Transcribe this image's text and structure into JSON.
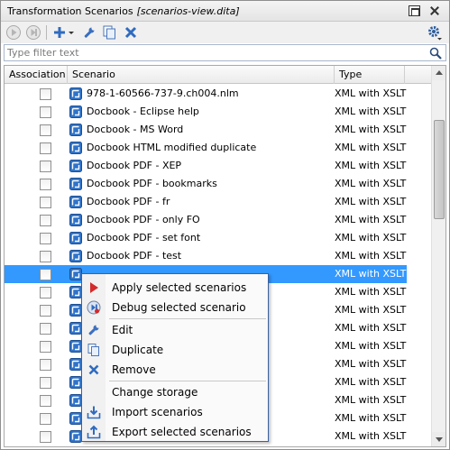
{
  "panel": {
    "title": "Transformation Scenarios",
    "document": "[scenarios-view.dita]"
  },
  "toolbar": {
    "icons": [
      "apply-icon",
      "debug-icon",
      "add-icon",
      "dropdown-arrow-icon",
      "edit-icon",
      "duplicate-icon",
      "remove-icon",
      "settings-icon"
    ]
  },
  "filter": {
    "placeholder": "Type filter text",
    "value": ""
  },
  "table": {
    "columns": [
      "Association",
      "Scenario",
      "Type"
    ],
    "rows": [
      {
        "scenario": "978-1-60566-737-9.ch004.nlm",
        "type": "XML with XSLT",
        "checked": false,
        "selected": false
      },
      {
        "scenario": "Docbook - Eclipse help",
        "type": "XML with XSLT",
        "checked": false,
        "selected": false
      },
      {
        "scenario": "Docbook - MS Word",
        "type": "XML with XSLT",
        "checked": false,
        "selected": false
      },
      {
        "scenario": "Docbook HTML modified duplicate",
        "type": "XML with XSLT",
        "checked": false,
        "selected": false
      },
      {
        "scenario": "Docbook PDF - XEP",
        "type": "XML with XSLT",
        "checked": false,
        "selected": false
      },
      {
        "scenario": "Docbook PDF - bookmarks",
        "type": "XML with XSLT",
        "checked": false,
        "selected": false
      },
      {
        "scenario": "Docbook PDF - fr",
        "type": "XML with XSLT",
        "checked": false,
        "selected": false
      },
      {
        "scenario": "Docbook PDF - only FO",
        "type": "XML with XSLT",
        "checked": false,
        "selected": false
      },
      {
        "scenario": "Docbook PDF - set font",
        "type": "XML with XSLT",
        "checked": false,
        "selected": false
      },
      {
        "scenario": "Docbook PDF - test",
        "type": "XML with XSLT",
        "checked": false,
        "selected": false
      },
      {
        "scenario": "",
        "type": "XML with XSLT",
        "checked": false,
        "selected": true
      },
      {
        "scenario": "",
        "type": "XML with XSLT",
        "checked": false,
        "selected": false
      },
      {
        "scenario": "",
        "type": "XML with XSLT",
        "checked": false,
        "selected": false
      },
      {
        "scenario": "",
        "type": "XML with XSLT",
        "checked": false,
        "selected": false
      },
      {
        "scenario": "",
        "type": "XML with XSLT",
        "checked": false,
        "selected": false
      },
      {
        "scenario": "",
        "type": "XML with XSLT",
        "checked": false,
        "selected": false
      },
      {
        "scenario": "",
        "type": "XML with XSLT",
        "checked": false,
        "selected": false
      },
      {
        "scenario": "",
        "type": "XML with XSLT",
        "checked": false,
        "selected": false
      },
      {
        "scenario": "",
        "type": "XML with XSLT",
        "checked": false,
        "selected": false
      },
      {
        "scenario": "",
        "type": "XML with XSLT",
        "checked": false,
        "selected": false
      }
    ]
  },
  "context_menu": {
    "items": [
      {
        "label": "Apply selected scenarios",
        "icon": "apply-icon"
      },
      {
        "label": "Debug selected scenario",
        "icon": "debug-icon"
      },
      {
        "label": "Edit",
        "icon": "edit-icon"
      },
      {
        "label": "Duplicate",
        "icon": "duplicate-icon"
      },
      {
        "label": "Remove",
        "icon": "remove-icon"
      },
      {
        "label": "Change storage",
        "icon": ""
      },
      {
        "label": "Import scenarios",
        "icon": "import-icon"
      },
      {
        "label": "Export selected scenarios",
        "icon": "export-icon"
      }
    ]
  },
  "colors": {
    "selection": "#3399ff",
    "menu_border": "#3a61a0",
    "apply_red": "#d42a2a",
    "icon_blue": "#2f6bc0"
  }
}
